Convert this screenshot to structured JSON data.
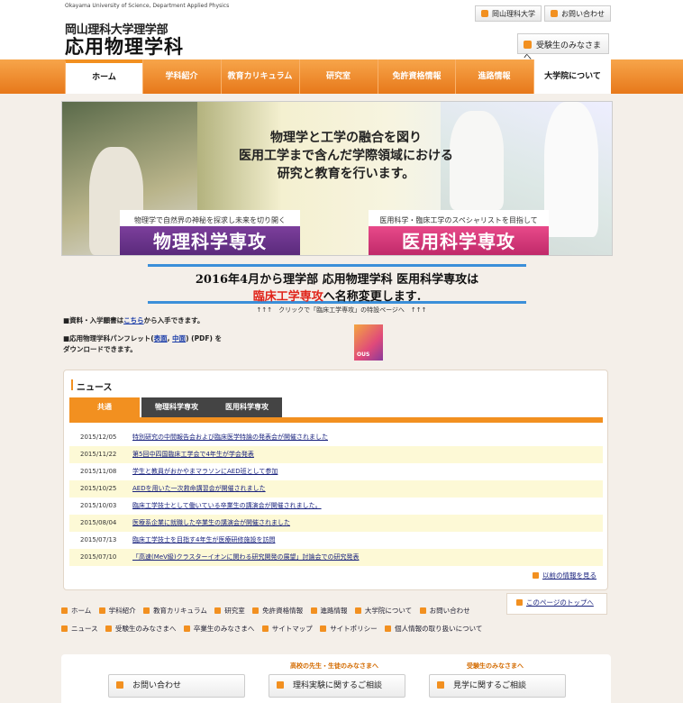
{
  "header": {
    "univ_en": "Okayama University of Science, Department Applied Physics",
    "subtitle": "岡山理科大学理学部",
    "title": "応用物理学科",
    "link_univ": "岡山理科大学",
    "link_contact": "お問い合わせ",
    "juken_btn": "受験生のみなさまへ"
  },
  "nav": [
    "ホーム",
    "学科紹介",
    "教育カリキュラム",
    "研究室",
    "免許資格情報",
    "進路情報",
    "大学院について"
  ],
  "hero": {
    "copy1": "物理学と工学の融合を図り",
    "copy2": "医用工学まで含んだ学際領域における",
    "copy3": "研究と教育を行います。",
    "phys_small": "物理学で自然界の神秘を探求し未来を切り開く",
    "phys_big": "物理科学専攻",
    "med_small": "医用科学・臨床工学のスペシャリストを目指して",
    "med_big": "医用科学専攻"
  },
  "announce": {
    "line1": "2016年4月から理学部 応用物理学科 医用科学専攻は",
    "line2_red": "臨床工学専攻",
    "line2_rest": "へ名称変更します.",
    "click_note": "↑↑↑　クリックで「臨床工学専攻」の特設ページへ　↑↑↑"
  },
  "info": {
    "l1_pre": "■資料・入学願書は",
    "l1_link": "こちら",
    "l1_post": "から入手できます。",
    "l2_pre": "■応用物理学科パンフレット(",
    "l2_link1": "表面",
    "l2_sep": ", ",
    "l2_link2": "中面",
    "l2_post": ") (PDF) を",
    "l3": "ダウンロードできます。",
    "pamph_label": "OUS"
  },
  "news": {
    "title": "ニュース",
    "tabs": [
      "共通",
      "物理科学専攻",
      "医用科学専攻"
    ],
    "items": [
      {
        "date": "2015/12/05",
        "text": "特別研究の中間報告会および臨床医学特論の発表会が開催されました"
      },
      {
        "date": "2015/11/22",
        "text": "第5回中四国臨床工学会で4年生が学会発表"
      },
      {
        "date": "2015/11/08",
        "text": "学生と教員がおかやまマラソンにAED班として参加"
      },
      {
        "date": "2015/10/25",
        "text": "AEDを用いた一次救命講習会が開催されました"
      },
      {
        "date": "2015/10/03",
        "text": "臨床工学技士として働いている卒業生の講演会が開催されました。"
      },
      {
        "date": "2015/08/04",
        "text": "医療系企業に就職した卒業生の講演会が開催されました"
      },
      {
        "date": "2015/07/13",
        "text": "臨床工学技士を目指す4年生が医療研修施設を訪問"
      },
      {
        "date": "2015/07/10",
        "text": "「高速(MeV級)クラスターイオンに関わる研究開発の展望」討論会での研究発表"
      }
    ],
    "more": "以前の情報を見る"
  },
  "footer": {
    "pagetop": "このページのトップへ",
    "links1": [
      "ホーム",
      "学科紹介",
      "教育カリキュラム",
      "研究室",
      "免許資格情報",
      "進路情報",
      "大学院について",
      "お問い合わせ"
    ],
    "links2": [
      "ニュース",
      "受験生のみなさまへ",
      "卒業生のみなさまへ",
      "サイトマップ",
      "サイトポリシー",
      "個人情報の取り扱いについて"
    ],
    "cap_teachers": "高校の先生・生徒のみなさまへ",
    "cap_examinees": "受験生のみなさまへ",
    "btn_contact": "お問い合わせ",
    "btn_experiment": "理科実験に関するご相談",
    "btn_visit": "見学に関するご相談"
  },
  "colors": {
    "accent": "#f29020",
    "link": "#1a237e",
    "announce_border": "#3b8fd9",
    "highlight": "#e0251b"
  }
}
